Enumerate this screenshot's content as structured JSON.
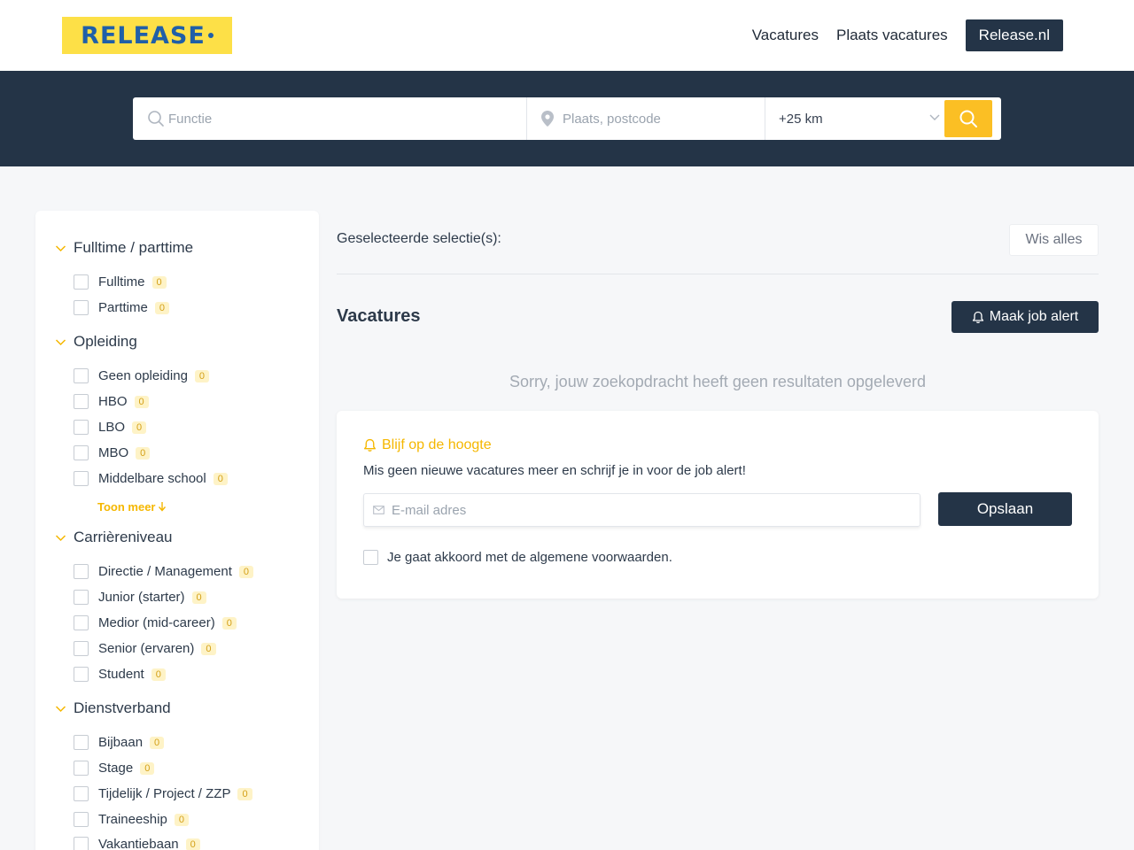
{
  "header": {
    "logo_text": "RELEASE",
    "nav": [
      "Vacatures",
      "Plaats vacatures"
    ],
    "nav_button": "Release.nl"
  },
  "search": {
    "functie_placeholder": "Functie",
    "plaats_placeholder": "Plaats, postcode",
    "range_value": "+25 km"
  },
  "filters": {
    "groups": [
      {
        "title": "Fulltime / parttime",
        "items": [
          {
            "label": "Fulltime",
            "count": "0"
          },
          {
            "label": "Parttime",
            "count": "0"
          }
        ]
      },
      {
        "title": "Opleiding",
        "items": [
          {
            "label": "Geen opleiding",
            "count": "0"
          },
          {
            "label": "HBO",
            "count": "0"
          },
          {
            "label": "LBO",
            "count": "0"
          },
          {
            "label": "MBO",
            "count": "0"
          },
          {
            "label": "Middelbare school",
            "count": "0"
          }
        ],
        "more_label": "Toon meer"
      },
      {
        "title": "Carrièreniveau",
        "items": [
          {
            "label": "Directie / Management",
            "count": "0"
          },
          {
            "label": "Junior (starter)",
            "count": "0"
          },
          {
            "label": "Medior (mid-career)",
            "count": "0"
          },
          {
            "label": "Senior (ervaren)",
            "count": "0"
          },
          {
            "label": "Student",
            "count": "0"
          }
        ]
      },
      {
        "title": "Dienstverband",
        "items": [
          {
            "label": "Bijbaan",
            "count": "0"
          },
          {
            "label": "Stage",
            "count": "0"
          },
          {
            "label": "Tijdelijk / Project / ZZP",
            "count": "0"
          },
          {
            "label": "Traineeship",
            "count": "0"
          },
          {
            "label": "Vakantiebaan",
            "count": "0"
          }
        ]
      }
    ]
  },
  "main": {
    "selection_title": "Geselecteerde selectie(s):",
    "clear_all": "Wis alles",
    "vacatures_title": "Vacatures",
    "job_alert_button": "Maak job alert",
    "no_results": "Sorry, jouw zoekopdracht heeft geen resultaten opgeleverd"
  },
  "alert_card": {
    "title": "Blijf op de hoogte",
    "subtitle": "Mis geen nieuwe vacatures meer en schrijf je in voor de job alert!",
    "email_placeholder": "E-mail adres",
    "save_button": "Opslaan",
    "terms": "Je gaat akkoord met de algemene voorwaarden."
  },
  "colors": {
    "navy": "#243447",
    "accent_yellow": "#fbbf24",
    "logo_yellow": "#fde047",
    "logo_blue": "#1f5fa8"
  },
  "icons": [
    "search-icon",
    "location-pin-icon",
    "chevron-down-icon",
    "bell-icon",
    "mail-icon",
    "arrow-down-icon"
  ]
}
